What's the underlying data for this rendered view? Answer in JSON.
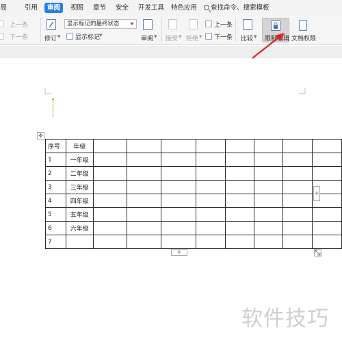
{
  "menu": {
    "items": [
      {
        "label": "布局",
        "active": false
      },
      {
        "label": "引用",
        "active": false
      },
      {
        "label": "审阅",
        "active": true
      },
      {
        "label": "视图",
        "active": false
      },
      {
        "label": "章节",
        "active": false
      },
      {
        "label": "安全",
        "active": false
      },
      {
        "label": "开发工具",
        "active": false
      },
      {
        "label": "特色应用",
        "active": false
      }
    ],
    "search_placeholder": "查找命令、搜索模板"
  },
  "ribbon": {
    "prev_left": "上一条",
    "next_left": "下一条",
    "revise": "修订",
    "display_combo": "显示标记的最终状态",
    "show_markup": "显示标记",
    "review": "审阅",
    "accept": "接受",
    "reject": "拒绝",
    "prev": "上一条",
    "next": "下一条",
    "compare": "比较",
    "restrict_edit": "限制编辑",
    "doc_permission": "文档权限"
  },
  "table": {
    "rows": [
      [
        "序号",
        "年级"
      ],
      [
        "1",
        "一年级"
      ],
      [
        "2",
        "二年级"
      ],
      [
        "3",
        "三年级"
      ],
      [
        "4",
        "四年级"
      ],
      [
        "5",
        "五年级"
      ],
      [
        "6",
        "六年级"
      ],
      [
        "7",
        ""
      ]
    ],
    "extra_columns": 8
  },
  "watermark": "软件技巧",
  "colors": {
    "active_tab": "#2b7de9",
    "annotation_arrow": "#e02424",
    "cursor": "#c9b43a"
  }
}
